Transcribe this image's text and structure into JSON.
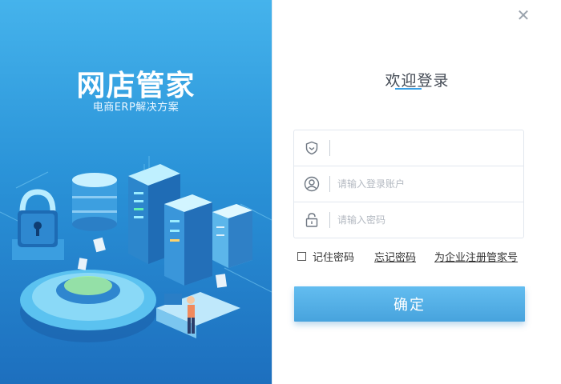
{
  "brand": {
    "title": "网店管家",
    "subtitle": "电商ERP解决方案"
  },
  "login": {
    "heading": "欢迎登录",
    "fields": [
      {
        "icon": "shield-icon",
        "value": "",
        "placeholder": ""
      },
      {
        "icon": "user-icon",
        "value": "",
        "placeholder": "请输入登录账户"
      },
      {
        "icon": "lock-icon",
        "value": "",
        "placeholder": "请输入密码"
      }
    ],
    "remember_label": "记住密码",
    "remember_checked": false,
    "forgot_label": "忘记密码",
    "register_label": "为企业注册管家号",
    "confirm_label": "确定"
  },
  "window": {
    "close_glyph": "✕"
  },
  "colors": {
    "panel_top": "#45b3ec",
    "panel_bottom": "#1d6fbe",
    "accent": "#3aa0e6",
    "button": "#52ade5"
  }
}
